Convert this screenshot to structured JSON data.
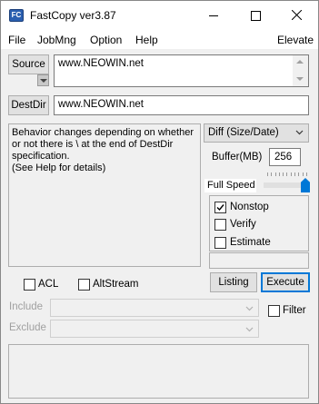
{
  "titlebar": {
    "icon_text": "FC",
    "title": "FastCopy ver3.87"
  },
  "menu": [
    "File",
    "JobMng",
    "Option",
    "Help",
    "Elevate"
  ],
  "source": {
    "button_label": "Source",
    "value": "www.NEOWIN.net"
  },
  "destdir": {
    "button_label": "DestDir",
    "value": "www.NEOWIN.net"
  },
  "info_text": "Behavior changes depending on whether or not there is \\ at the end of DestDir specification.\n(See Help for details)",
  "mode_select": "Diff (Size/Date)",
  "buffer": {
    "label": "Buffer(MB)",
    "value": "256"
  },
  "speed": {
    "label": "Full Speed",
    "level_fraction": 1.0
  },
  "options": [
    {
      "label": "Nonstop",
      "checked": true
    },
    {
      "label": "Verify",
      "checked": false
    },
    {
      "label": "Estimate",
      "checked": false
    }
  ],
  "actions": {
    "listing": "Listing",
    "execute": "Execute"
  },
  "streams": {
    "acl": "ACL",
    "altstream": "AltStream"
  },
  "filters": {
    "include_label": "Include",
    "exclude_label": "Exclude",
    "filter_label": "Filter"
  },
  "colors": {
    "accent": "#0078d7"
  }
}
